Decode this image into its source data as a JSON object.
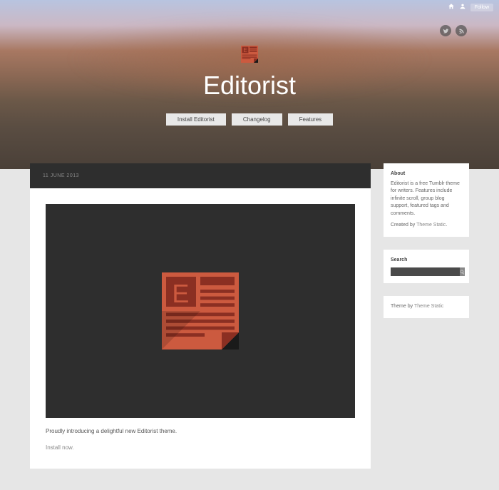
{
  "topbar": {
    "follow_label": "Follow"
  },
  "hero": {
    "title": "Editorist",
    "nav": [
      {
        "label": "Install Editorist"
      },
      {
        "label": "Changelog"
      },
      {
        "label": "Features"
      }
    ]
  },
  "post": {
    "date": "11 JUNE 2013",
    "intro": "Proudly introducing a delightful new Editorist theme.",
    "link_text": "Install now."
  },
  "sidebar": {
    "about": {
      "title": "About",
      "body": "Editorist is a free Tumblr theme for writers. Features include infinite scroll, group blog support, featured tags and comments.",
      "created_by_prefix": "Created by ",
      "created_by_link": "Theme Static",
      "suffix": "."
    },
    "search": {
      "title": "Search",
      "placeholder": ""
    },
    "credit": {
      "prefix": "Theme by ",
      "link": "Theme Static"
    }
  }
}
